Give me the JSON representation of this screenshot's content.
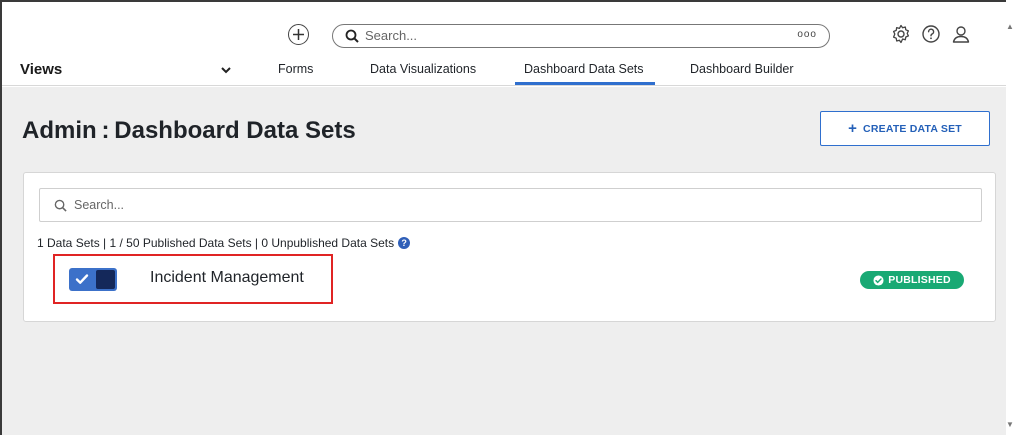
{
  "topbar": {
    "search_placeholder": "Search...",
    "search_options_glyph": "ooo",
    "icons": [
      "add-icon",
      "search-icon",
      "gear-icon",
      "help-icon",
      "user-icon"
    ]
  },
  "nav": {
    "views_label": "Views",
    "tabs": [
      {
        "label": "Forms",
        "active": false
      },
      {
        "label": "Data Visualizations",
        "active": false
      },
      {
        "label": "Dashboard Data Sets",
        "active": true
      },
      {
        "label": "Dashboard Builder",
        "active": false
      }
    ]
  },
  "page": {
    "title": "Admin : Dashboard Data Sets",
    "create_button_label": "CREATE DATA SET",
    "search_placeholder": "Search...",
    "stats": "1 Data Sets | 1 / 50 Published Data Sets | 0 Unpublished Data Sets"
  },
  "data_sets": [
    {
      "name": "Incident Management",
      "enabled": true,
      "status": "PUBLISHED"
    }
  ],
  "colors": {
    "accent": "#2f6fce",
    "toggle_on": "#3c71c9",
    "published": "#19a974",
    "highlight": "#e02424",
    "background": "#eeeeee"
  }
}
